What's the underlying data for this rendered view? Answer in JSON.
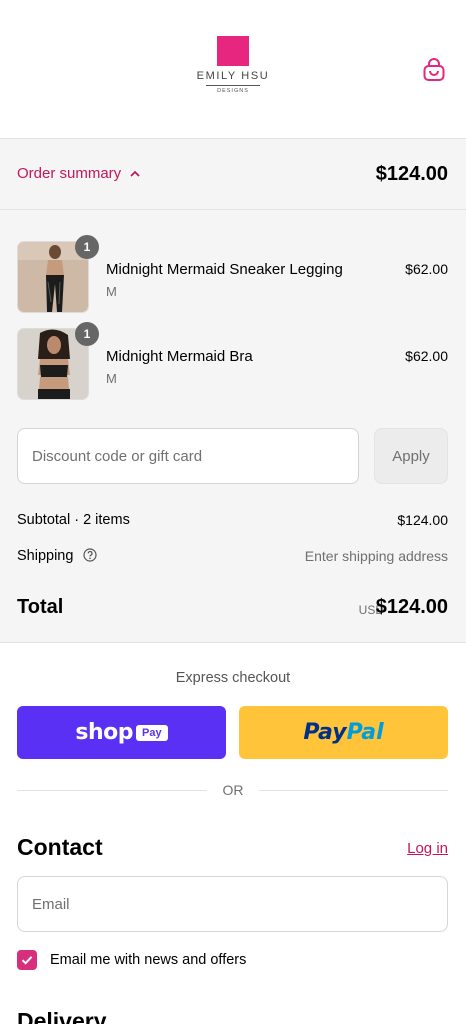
{
  "brand": {
    "name": "EMILY HSU",
    "sub": "DESIGNS",
    "accent": "#e6267f"
  },
  "order_summary": {
    "toggle_label": "Order summary",
    "total": "$124.00",
    "items": [
      {
        "name": "Midnight Mermaid Sneaker Legging",
        "variant": "M",
        "price": "$62.00",
        "quantity": "1"
      },
      {
        "name": "Midnight Mermaid Bra",
        "variant": "M",
        "price": "$62.00",
        "quantity": "1"
      }
    ],
    "discount_placeholder": "Discount code or gift card",
    "apply_label": "Apply",
    "subtotal_label": "Subtotal · 2 items",
    "subtotal_value": "$124.00",
    "shipping_label": "Shipping",
    "shipping_value": "Enter shipping address",
    "total_label": "Total",
    "total_currency": "USD",
    "total_value": "$124.00"
  },
  "express": {
    "title": "Express checkout",
    "shop_word": "shop",
    "shop_pay_badge": "Pay",
    "paypal_a": "Pay",
    "paypal_b": "Pal",
    "or_label": "OR"
  },
  "contact": {
    "title": "Contact",
    "login_label": "Log in",
    "email_placeholder": "Email",
    "newsletter_label": "Email me with news and offers",
    "newsletter_checked": true
  },
  "delivery": {
    "title": "Delivery"
  }
}
